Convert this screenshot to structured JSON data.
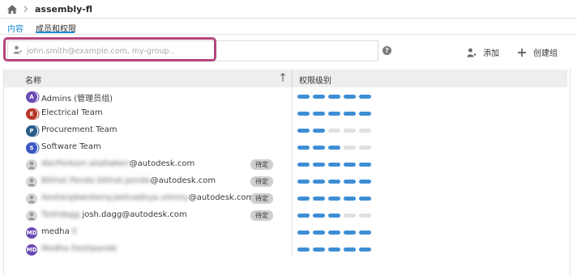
{
  "breadcrumb": {
    "title": "assembly-fl"
  },
  "tabs": [
    {
      "label": "内容",
      "active": false
    },
    {
      "label": "成员和权限",
      "active": true
    }
  ],
  "search": {
    "placeholder": "john.smith@example.com, my-group.."
  },
  "actions": {
    "add_label": "添加",
    "create_group_label": "创建组"
  },
  "table": {
    "columns": {
      "name": "名称",
      "permission": "权限级别"
    },
    "rows": [
      {
        "type": "group",
        "initial": "A",
        "avatar_color": "#6a4bb3",
        "name": "Admins (管理员组)",
        "pending": "",
        "level": 5
      },
      {
        "type": "group",
        "initial": "E",
        "avatar_color": "#b7352a",
        "name": "Electrical Team",
        "pending": "",
        "level": 5
      },
      {
        "type": "group",
        "initial": "P",
        "avatar_color": "#2a5c8a",
        "name": "Procurement Team",
        "pending": "",
        "level": 2
      },
      {
        "type": "group",
        "initial": "S",
        "avatar_color": "#3b57c4",
        "name": "Software Team",
        "pending": "",
        "level": 3
      },
      {
        "type": "user",
        "initial": "",
        "avatar_color": "#d6d6d6",
        "name_blur": "AbcPerkam.alsdiwken",
        "name": "@autodesk.com",
        "pending": "待定",
        "level": 5
      },
      {
        "type": "user",
        "initial": "",
        "avatar_color": "#d6d6d6",
        "name_blur": "Bikhat Penda bikhat.penda",
        "name": "@autodesk.com",
        "pending": "待定",
        "level": 5
      },
      {
        "type": "user",
        "initial": "",
        "avatar_color": "#d6d6d6",
        "name_blur": "Aeetanpbwvbeny.jaetvadnya.vimmy",
        "name": "@autodesk.com",
        "pending": "待定",
        "level": 5
      },
      {
        "type": "user",
        "initial": "",
        "avatar_color": "#d6d6d6",
        "name_blur": "Toshdagg",
        "name": "josh.dagg@autodesk.com",
        "pending": "待定",
        "level": 3
      },
      {
        "type": "member",
        "initial": "MD",
        "avatar_color": "#6a4bb3",
        "name": "medha",
        "name_blur": "ll",
        "pending": "",
        "level": 5
      },
      {
        "type": "member",
        "initial": "MD",
        "avatar_color": "#6a4bb3",
        "name": "",
        "name_blur": "Medha Deshpande",
        "pending": "",
        "level": 5
      }
    ]
  },
  "colors": {
    "accent": "#1b8ad6",
    "permission_on": "#3e8ed5",
    "permission_off": "#e0e0e0",
    "search_highlight": "#b5467d"
  }
}
